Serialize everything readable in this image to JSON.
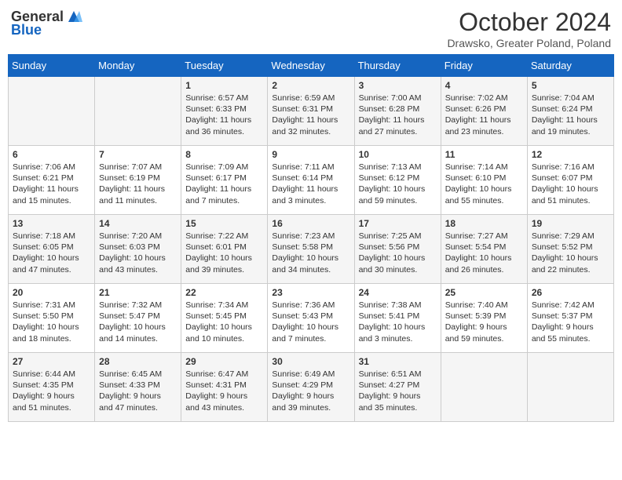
{
  "header": {
    "logo_general": "General",
    "logo_blue": "Blue",
    "month": "October 2024",
    "location": "Drawsko, Greater Poland, Poland"
  },
  "weekdays": [
    "Sunday",
    "Monday",
    "Tuesday",
    "Wednesday",
    "Thursday",
    "Friday",
    "Saturday"
  ],
  "weeks": [
    [
      {
        "day": "",
        "info": ""
      },
      {
        "day": "",
        "info": ""
      },
      {
        "day": "1",
        "info": "Sunrise: 6:57 AM\nSunset: 6:33 PM\nDaylight: 11 hours and 36 minutes."
      },
      {
        "day": "2",
        "info": "Sunrise: 6:59 AM\nSunset: 6:31 PM\nDaylight: 11 hours and 32 minutes."
      },
      {
        "day": "3",
        "info": "Sunrise: 7:00 AM\nSunset: 6:28 PM\nDaylight: 11 hours and 27 minutes."
      },
      {
        "day": "4",
        "info": "Sunrise: 7:02 AM\nSunset: 6:26 PM\nDaylight: 11 hours and 23 minutes."
      },
      {
        "day": "5",
        "info": "Sunrise: 7:04 AM\nSunset: 6:24 PM\nDaylight: 11 hours and 19 minutes."
      }
    ],
    [
      {
        "day": "6",
        "info": "Sunrise: 7:06 AM\nSunset: 6:21 PM\nDaylight: 11 hours and 15 minutes."
      },
      {
        "day": "7",
        "info": "Sunrise: 7:07 AM\nSunset: 6:19 PM\nDaylight: 11 hours and 11 minutes."
      },
      {
        "day": "8",
        "info": "Sunrise: 7:09 AM\nSunset: 6:17 PM\nDaylight: 11 hours and 7 minutes."
      },
      {
        "day": "9",
        "info": "Sunrise: 7:11 AM\nSunset: 6:14 PM\nDaylight: 11 hours and 3 minutes."
      },
      {
        "day": "10",
        "info": "Sunrise: 7:13 AM\nSunset: 6:12 PM\nDaylight: 10 hours and 59 minutes."
      },
      {
        "day": "11",
        "info": "Sunrise: 7:14 AM\nSunset: 6:10 PM\nDaylight: 10 hours and 55 minutes."
      },
      {
        "day": "12",
        "info": "Sunrise: 7:16 AM\nSunset: 6:07 PM\nDaylight: 10 hours and 51 minutes."
      }
    ],
    [
      {
        "day": "13",
        "info": "Sunrise: 7:18 AM\nSunset: 6:05 PM\nDaylight: 10 hours and 47 minutes."
      },
      {
        "day": "14",
        "info": "Sunrise: 7:20 AM\nSunset: 6:03 PM\nDaylight: 10 hours and 43 minutes."
      },
      {
        "day": "15",
        "info": "Sunrise: 7:22 AM\nSunset: 6:01 PM\nDaylight: 10 hours and 39 minutes."
      },
      {
        "day": "16",
        "info": "Sunrise: 7:23 AM\nSunset: 5:58 PM\nDaylight: 10 hours and 34 minutes."
      },
      {
        "day": "17",
        "info": "Sunrise: 7:25 AM\nSunset: 5:56 PM\nDaylight: 10 hours and 30 minutes."
      },
      {
        "day": "18",
        "info": "Sunrise: 7:27 AM\nSunset: 5:54 PM\nDaylight: 10 hours and 26 minutes."
      },
      {
        "day": "19",
        "info": "Sunrise: 7:29 AM\nSunset: 5:52 PM\nDaylight: 10 hours and 22 minutes."
      }
    ],
    [
      {
        "day": "20",
        "info": "Sunrise: 7:31 AM\nSunset: 5:50 PM\nDaylight: 10 hours and 18 minutes."
      },
      {
        "day": "21",
        "info": "Sunrise: 7:32 AM\nSunset: 5:47 PM\nDaylight: 10 hours and 14 minutes."
      },
      {
        "day": "22",
        "info": "Sunrise: 7:34 AM\nSunset: 5:45 PM\nDaylight: 10 hours and 10 minutes."
      },
      {
        "day": "23",
        "info": "Sunrise: 7:36 AM\nSunset: 5:43 PM\nDaylight: 10 hours and 7 minutes."
      },
      {
        "day": "24",
        "info": "Sunrise: 7:38 AM\nSunset: 5:41 PM\nDaylight: 10 hours and 3 minutes."
      },
      {
        "day": "25",
        "info": "Sunrise: 7:40 AM\nSunset: 5:39 PM\nDaylight: 9 hours and 59 minutes."
      },
      {
        "day": "26",
        "info": "Sunrise: 7:42 AM\nSunset: 5:37 PM\nDaylight: 9 hours and 55 minutes."
      }
    ],
    [
      {
        "day": "27",
        "info": "Sunrise: 6:44 AM\nSunset: 4:35 PM\nDaylight: 9 hours and 51 minutes."
      },
      {
        "day": "28",
        "info": "Sunrise: 6:45 AM\nSunset: 4:33 PM\nDaylight: 9 hours and 47 minutes."
      },
      {
        "day": "29",
        "info": "Sunrise: 6:47 AM\nSunset: 4:31 PM\nDaylight: 9 hours and 43 minutes."
      },
      {
        "day": "30",
        "info": "Sunrise: 6:49 AM\nSunset: 4:29 PM\nDaylight: 9 hours and 39 minutes."
      },
      {
        "day": "31",
        "info": "Sunrise: 6:51 AM\nSunset: 4:27 PM\nDaylight: 9 hours and 35 minutes."
      },
      {
        "day": "",
        "info": ""
      },
      {
        "day": "",
        "info": ""
      }
    ]
  ]
}
